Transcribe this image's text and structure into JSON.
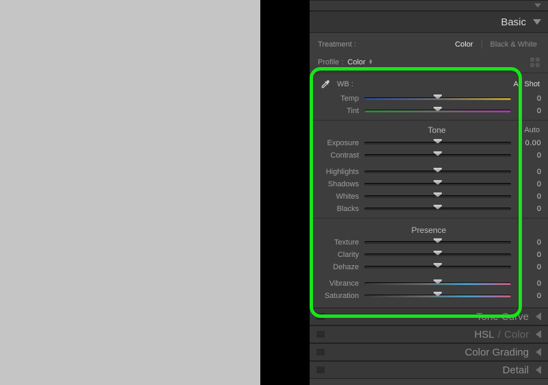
{
  "highlight_color": "#17e51a",
  "panels": {
    "basic": {
      "title": "Basic",
      "expanded": true
    },
    "tone_curve": {
      "title": "Tone Curve"
    },
    "hsl_color": {
      "title_a": "HSL",
      "title_b": "Color"
    },
    "color_grading": {
      "title": "Color Grading"
    },
    "detail": {
      "title": "Detail"
    }
  },
  "treatment": {
    "label": "Treatment :",
    "options": {
      "color": "Color",
      "bw": "Black & White"
    },
    "active": "color"
  },
  "profile": {
    "label": "Profile :",
    "value": "Color"
  },
  "wb": {
    "label": "WB :",
    "value": "As Shot"
  },
  "sliders": {
    "temp": {
      "label": "Temp",
      "value": "0"
    },
    "tint": {
      "label": "Tint",
      "value": "0"
    },
    "exposure": {
      "label": "Exposure",
      "value": "0.00"
    },
    "contrast": {
      "label": "Contrast",
      "value": "0"
    },
    "highlights": {
      "label": "Highlights",
      "value": "0"
    },
    "shadows": {
      "label": "Shadows",
      "value": "0"
    },
    "whites": {
      "label": "Whites",
      "value": "0"
    },
    "blacks": {
      "label": "Blacks",
      "value": "0"
    },
    "texture": {
      "label": "Texture",
      "value": "0"
    },
    "clarity": {
      "label": "Clarity",
      "value": "0"
    },
    "dehaze": {
      "label": "Dehaze",
      "value": "0"
    },
    "vibrance": {
      "label": "Vibrance",
      "value": "0"
    },
    "saturation": {
      "label": "Saturation",
      "value": "0"
    }
  },
  "groups": {
    "tone": {
      "title": "Tone",
      "auto": "Auto"
    },
    "presence": {
      "title": "Presence"
    }
  }
}
